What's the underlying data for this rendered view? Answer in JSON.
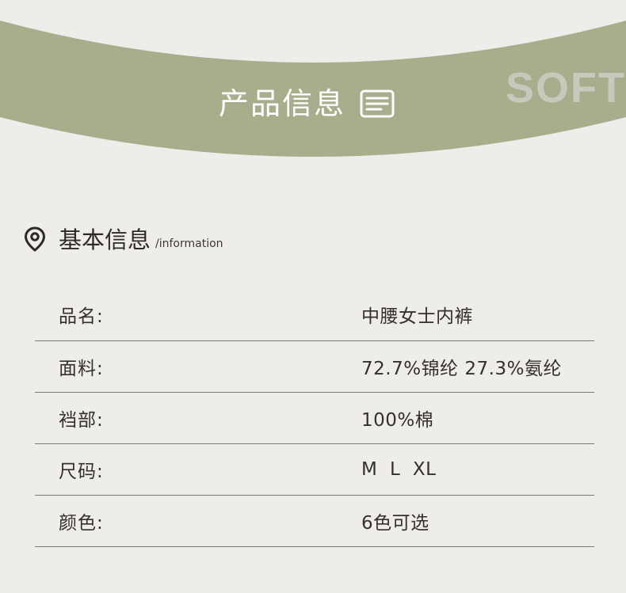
{
  "banner": {
    "title": "产品信息",
    "watermark": "SOFT",
    "icon": "document-list-icon",
    "color": "#a9ad8b"
  },
  "section": {
    "title": "基本信息",
    "subtitle": "/information",
    "icon": "location-pin-icon"
  },
  "specs": [
    {
      "label": "品名:",
      "value": "中腰女士内裤"
    },
    {
      "label": "面料:",
      "value": "72.7%锦纶 27.3%氨纶"
    },
    {
      "label": "裆部:",
      "value": "100%棉"
    },
    {
      "label": "尺码:",
      "value": "M  L  XL"
    },
    {
      "label": "颜色:",
      "value": "6色可选"
    }
  ],
  "colors": {
    "background": "#eeedea",
    "banner": "#a9ad8b",
    "text": "#33302e",
    "divider": "#7a7875"
  }
}
